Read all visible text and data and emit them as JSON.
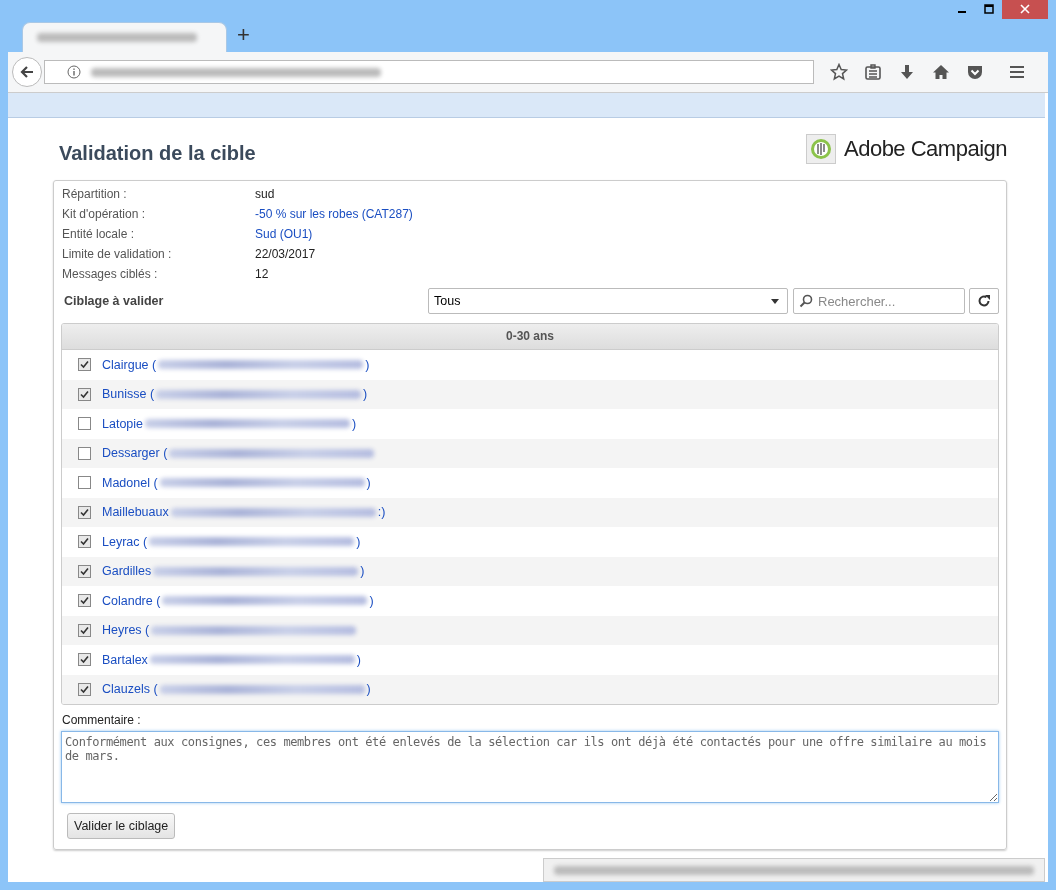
{
  "browser": {
    "new_tab": "+"
  },
  "page": {
    "title": "Validation de la cible",
    "logo": "Adobe Campaign",
    "fields": [
      {
        "label": "Répartition :",
        "value": "sud",
        "link": false
      },
      {
        "label": "Kit d'opération :",
        "value": "-50 % sur les robes (CAT287)",
        "link": true
      },
      {
        "label": "Entité locale :",
        "value": "Sud (OU1)",
        "link": true
      },
      {
        "label": "Limite de validation :",
        "value": "22/03/2017",
        "link": false
      },
      {
        "label": "Messages ciblés :",
        "value": "12",
        "link": false
      }
    ],
    "targeting": {
      "label": "Ciblage à valider",
      "filter": "Tous",
      "search": {
        "placeholder": "Rechercher..."
      }
    },
    "list": {
      "group": "0-30 ans",
      "rows": [
        {
          "name": "Clairgue (",
          "close": ")",
          "checked": true
        },
        {
          "name": "Bunisse (",
          "close": ")",
          "checked": true
        },
        {
          "name": "Latopie",
          "close": ")",
          "checked": false
        },
        {
          "name": "Dessarger (",
          "checked": false
        },
        {
          "name": "Madonel (",
          "close": ")",
          "checked": false
        },
        {
          "name": "Maillebuaux",
          "close": ":)",
          "checked": true
        },
        {
          "name": "Leyrac (",
          "close": ")",
          "checked": true
        },
        {
          "name": "Gardilles",
          "close": ")",
          "checked": true
        },
        {
          "name": "Colandre (",
          "close": ")",
          "checked": true
        },
        {
          "name": "Heyres (",
          "checked": true
        },
        {
          "name": "Bartalex",
          "close": ")",
          "checked": true
        },
        {
          "name": "Clauzels (",
          "close": ")",
          "checked": true
        }
      ]
    },
    "comment": {
      "label": "Commentaire :",
      "value": "Conformément aux consignes, ces membres ont été enlevés de la sélection car ils ont déjà été contactés pour une offre similaire au mois de mars."
    },
    "submit": "Valider le ciblage"
  }
}
